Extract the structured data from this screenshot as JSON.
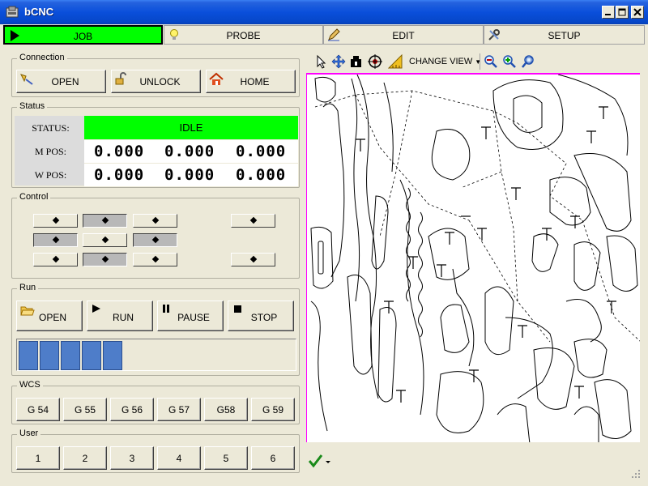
{
  "window": {
    "title": "bCNC"
  },
  "tabs": [
    {
      "label": "JOB",
      "icon": "play-icon"
    },
    {
      "label": "PROBE",
      "icon": "lightbulb-icon"
    },
    {
      "label": "EDIT",
      "icon": "pencil-icon"
    },
    {
      "label": "SETUP",
      "icon": "tools-icon"
    }
  ],
  "connection": {
    "title": "Connection",
    "buttons": [
      {
        "label": "OPEN",
        "icon": "serial-port-icon"
      },
      {
        "label": "UNLOCK",
        "icon": "unlock-icon"
      },
      {
        "label": "HOME",
        "icon": "home-icon"
      }
    ]
  },
  "status": {
    "title": "Status",
    "status_label": "STATUS:",
    "state": "IDLE",
    "state_color": "#00FF00",
    "mpos_label": "M POS:",
    "wpos_label": "W POS:",
    "mpos": [
      "0.000",
      "0.000",
      "0.000"
    ],
    "wpos": [
      "0.000",
      "0.000",
      "0.000"
    ]
  },
  "control": {
    "title": "Control"
  },
  "run": {
    "title": "Run",
    "buttons": [
      {
        "label": "OPEN",
        "icon": "folder-open-icon"
      },
      {
        "label": "RUN",
        "icon": "play-icon"
      },
      {
        "label": "PAUSE",
        "icon": "pause-icon"
      },
      {
        "label": "STOP",
        "icon": "stop-icon"
      }
    ],
    "progress_color": "#4E7DC9"
  },
  "wcs": {
    "title": "WCS",
    "buttons": [
      "G 54",
      "G 55",
      "G 56",
      "G 57",
      "G58",
      "G 59"
    ]
  },
  "user": {
    "title": "User",
    "buttons": [
      "1",
      "2",
      "3",
      "4",
      "5",
      "6"
    ]
  },
  "canvas_toolbar": {
    "change_view_label": "CHANGE VIEW",
    "tools": [
      "select-arrow-icon",
      "move-icon",
      "origin-icon",
      "crosshair-icon",
      "ruler-icon",
      "zoom-out-icon",
      "zoom-in-icon",
      "zoom-fit-icon"
    ]
  }
}
